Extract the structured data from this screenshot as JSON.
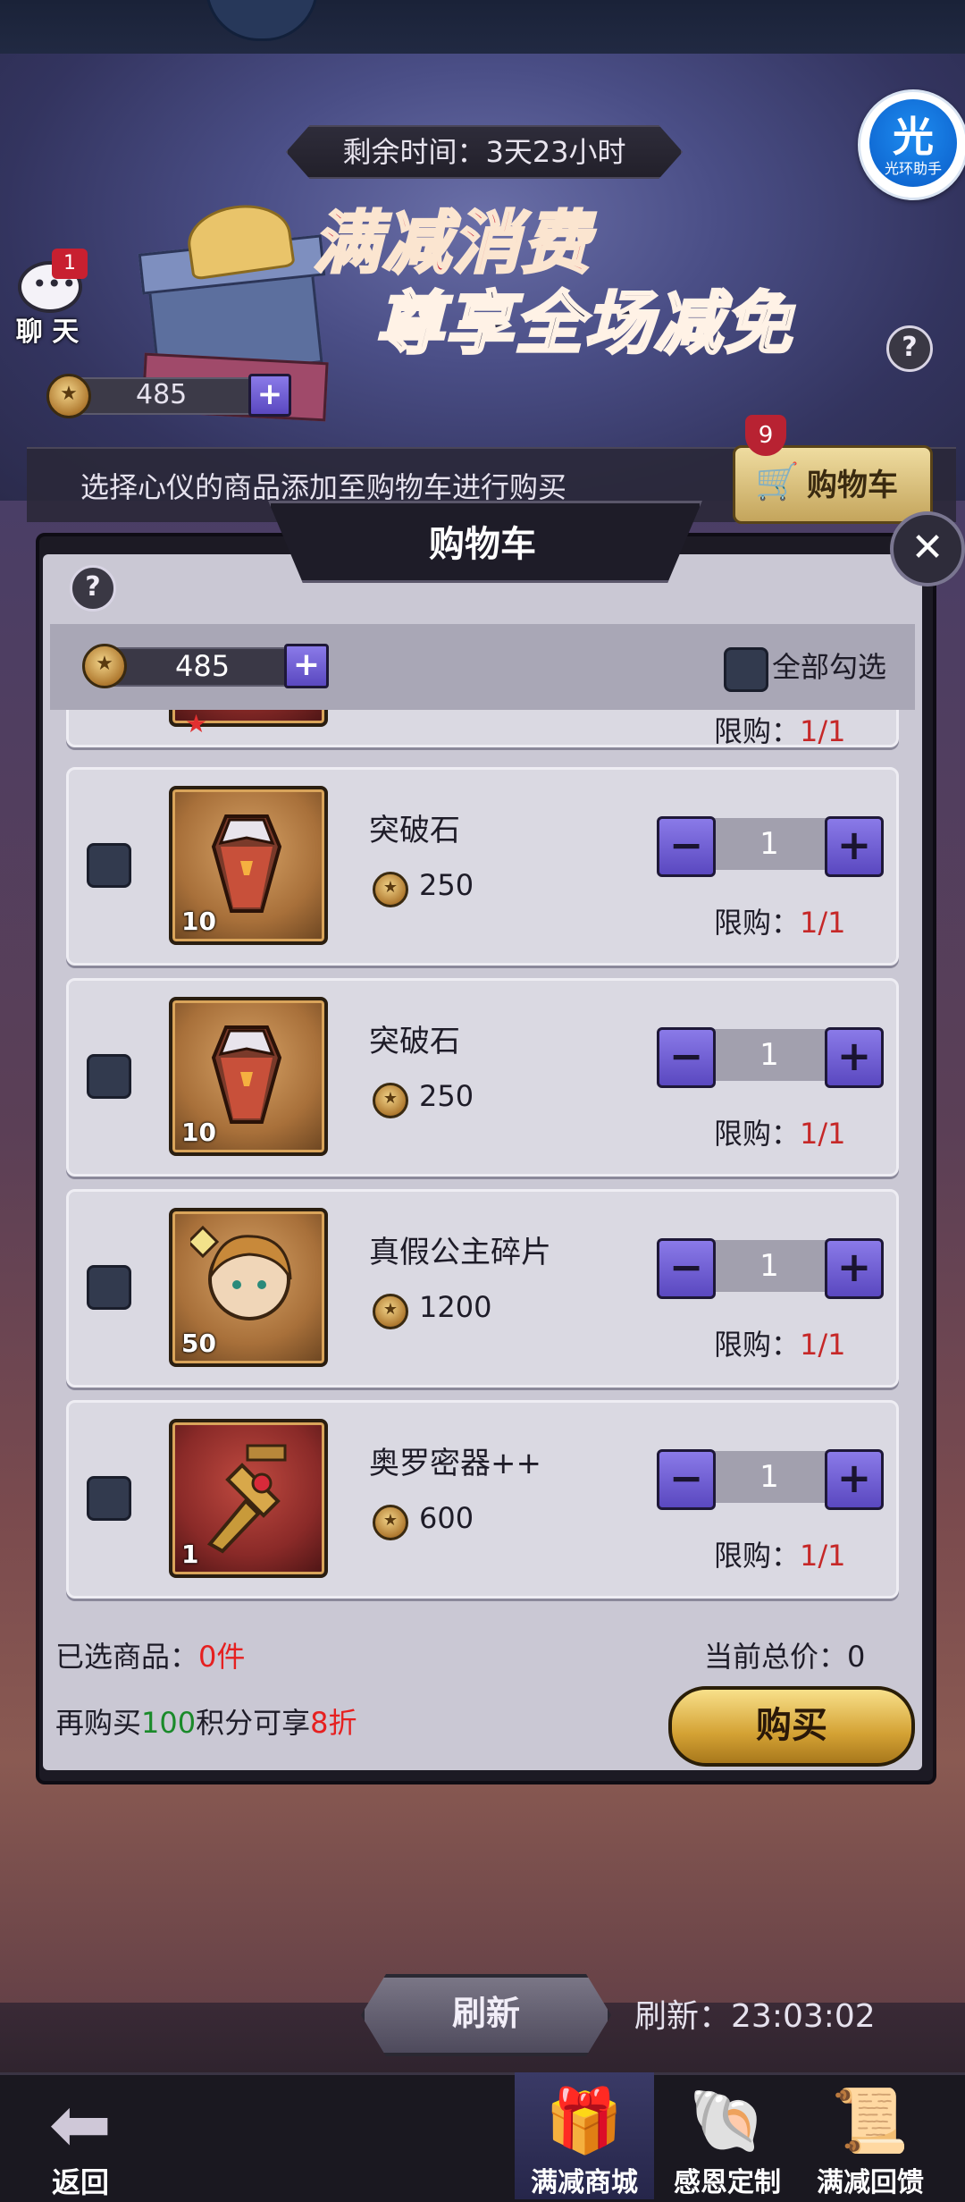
{
  "header": {
    "time_remaining": "剩余时间：3天23小时",
    "event_title_line1": "满减消费",
    "event_title_line2": "尊享全场减免",
    "help_glyph": "?",
    "assistant_glyph": "光",
    "assistant_label": "光环助手"
  },
  "chat": {
    "label": "聊 天",
    "badge": "1",
    "dots": "•••"
  },
  "currency": {
    "balance": "485",
    "plus": "+",
    "icon": "coin-star-icon"
  },
  "hint": {
    "text": "选择心仪的商品添加至购物车进行购买"
  },
  "cart_button": {
    "label": "购物车",
    "badge": "9",
    "icon": "cart-icon"
  },
  "panel": {
    "title": "购物车",
    "close_glyph": "✕",
    "help_glyph": "?",
    "balance": "485",
    "select_all_label": "全部勾选",
    "partial_limit_label": "限购：",
    "partial_limit_value": "1/1",
    "items": [
      {
        "name": "突破石",
        "price": "250",
        "qty_badge": "10",
        "quantity": "1",
        "limit_label": "限购：",
        "limit_value": "1/1",
        "icon": "breakthrough-stone-icon"
      },
      {
        "name": "突破石",
        "price": "250",
        "qty_badge": "10",
        "quantity": "1",
        "limit_label": "限购：",
        "limit_value": "1/1",
        "icon": "breakthrough-stone-icon"
      },
      {
        "name": "真假公主碎片",
        "price": "1200",
        "qty_badge": "50",
        "quantity": "1",
        "limit_label": "限购：",
        "limit_value": "1/1",
        "icon": "princess-shard-icon"
      },
      {
        "name": "奥罗密器++",
        "price": "600",
        "qty_badge": "1",
        "quantity": "1",
        "limit_label": "限购：",
        "limit_value": "1/1",
        "icon": "aurora-artifact-icon"
      }
    ],
    "step_minus": "−",
    "step_plus": "+"
  },
  "summary": {
    "selected_label": "已选商品：",
    "selected_value": "0件",
    "total_label": "当前总价：",
    "total_value": "0",
    "promo_prefix": "再购买",
    "promo_points": "100",
    "promo_mid": "积分可享",
    "promo_discount": "8折",
    "buy_label": "购买"
  },
  "refresh": {
    "button_label": "刷新",
    "timer_label": "刷新：",
    "timer_value": "23:03:02"
  },
  "bottom_nav": {
    "back_label": "返回",
    "tabs": [
      {
        "label": "满减商城",
        "icon": "gift-icon",
        "glyph": "🎁"
      },
      {
        "label": "感恩定制",
        "icon": "shell-icon",
        "glyph": "🐚"
      },
      {
        "label": "满减回馈",
        "icon": "scroll-icon",
        "glyph": "📜"
      }
    ],
    "active_tab": "满减商城"
  }
}
